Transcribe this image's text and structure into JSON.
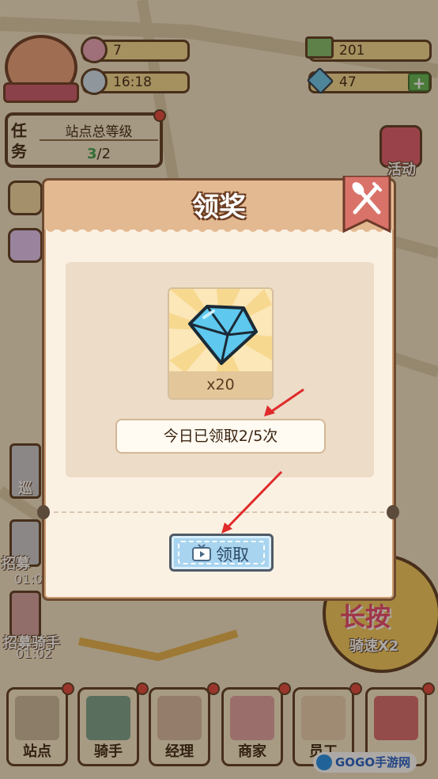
{
  "hud": {
    "stars": "7",
    "clock_time": "16:18",
    "cash": "201",
    "gems": "47",
    "activity_label": "活动"
  },
  "task_panel": {
    "label": "任务",
    "title": "站点总等级",
    "progress_current": "3",
    "progress_sep": "/2"
  },
  "side_items": [
    {
      "name": "巡",
      "timer": ""
    },
    {
      "name": "招募",
      "timer": "01:0"
    },
    {
      "name": "招募骑手",
      "timer": "01:02"
    }
  ],
  "long_press": {
    "line1": "长按",
    "line2": "骑速X2"
  },
  "bottom_nav": [
    {
      "label": "站点"
    },
    {
      "label": "骑手"
    },
    {
      "label": "经理"
    },
    {
      "label": "商家"
    },
    {
      "label": "员工"
    },
    {
      "label": ""
    }
  ],
  "modal": {
    "title": "领奖",
    "reward_icon": "diamond-icon",
    "reward_qty": "x20",
    "count_text": "今日已领取2/5次",
    "claim_label": "领取"
  },
  "watermark": "GOGO手游网",
  "colors": {
    "accent_blue": "#a8d4ef",
    "header_tan": "#e3b991",
    "arrow_red": "#e02a2a"
  }
}
